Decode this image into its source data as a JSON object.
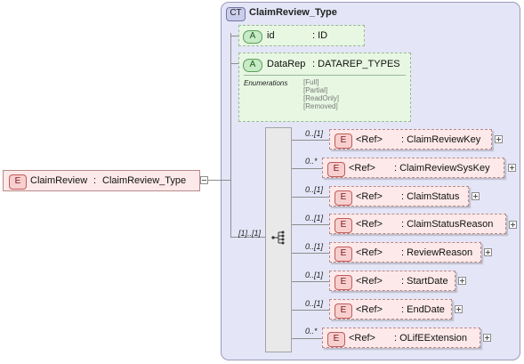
{
  "root_element": {
    "badge": "E",
    "name": "ClaimReview",
    "type": "ClaimReview_Type"
  },
  "complex_type": {
    "badge": "CT",
    "name": "ClaimReview_Type"
  },
  "attributes": [
    {
      "badge": "A",
      "name": "id",
      "type": ": ID"
    },
    {
      "badge": "A",
      "name": "DataRep",
      "type": ": DATAREP_TYPES",
      "enumerations_label": "Enumerations",
      "enumerations": [
        "[Full]",
        "[Partial]",
        "[ReadOnly]",
        "[Removed]"
      ]
    }
  ],
  "sequence": {
    "cardinality": "[1]..[1]"
  },
  "elements": [
    {
      "badge": "E",
      "ref": "<Ref>",
      "name": ": ClaimReviewKey",
      "cardinality": "0..[1]"
    },
    {
      "badge": "E",
      "ref": "<Ref>",
      "name": ": ClaimReviewSysKey",
      "cardinality": "0..*"
    },
    {
      "badge": "E",
      "ref": "<Ref>",
      "name": ": ClaimStatus",
      "cardinality": "0..[1]"
    },
    {
      "badge": "E",
      "ref": "<Ref>",
      "name": ": ClaimStatusReason",
      "cardinality": "0..[1]"
    },
    {
      "badge": "E",
      "ref": "<Ref>",
      "name": ": ReviewReason",
      "cardinality": "0..[1]"
    },
    {
      "badge": "E",
      "ref": "<Ref>",
      "name": ": StartDate",
      "cardinality": "0..[1]"
    },
    {
      "badge": "E",
      "ref": "<Ref>",
      "name": ": EndDate",
      "cardinality": "0..[1]"
    },
    {
      "badge": "E",
      "ref": "<Ref>",
      "name": ": OLifEExtension",
      "cardinality": "0..*"
    }
  ]
}
